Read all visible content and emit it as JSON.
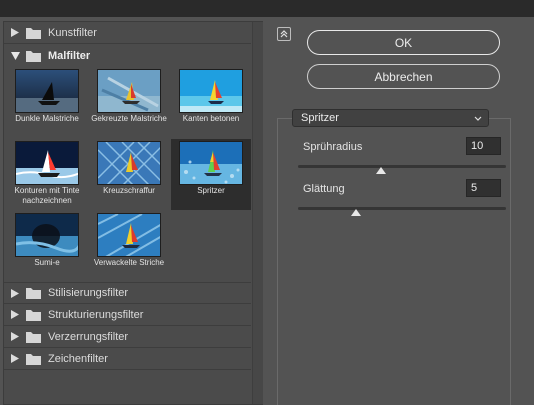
{
  "gallery": {
    "categories_top": [
      {
        "label": "Kunstfilter",
        "expanded": false,
        "icon": "folder-icon"
      },
      {
        "label": "Malfilter",
        "expanded": true,
        "icon": "folder-open-icon"
      }
    ],
    "malfilter_items": [
      {
        "label": "Dunkle Malstriche",
        "selected": false
      },
      {
        "label": "Gekreuzte Malstriche",
        "selected": false
      },
      {
        "label": "Kanten betonen",
        "selected": false
      },
      {
        "label": "Konturen mit Tinte nachzeichnen",
        "selected": false
      },
      {
        "label": "Kreuzschraffur",
        "selected": false
      },
      {
        "label": "Spritzer",
        "selected": true
      },
      {
        "label": "Sumi-e",
        "selected": false
      },
      {
        "label": "Verwackelte Striche",
        "selected": false
      }
    ],
    "categories_bottom": [
      {
        "label": "Stilisierungsfilter"
      },
      {
        "label": "Strukturierungsfilter"
      },
      {
        "label": "Verzerrungsfilter"
      },
      {
        "label": "Zeichenfilter"
      }
    ]
  },
  "buttons": {
    "ok_label": "OK",
    "cancel_label": "Abbrechen"
  },
  "filter_select": {
    "value": "Spritzer"
  },
  "params": [
    {
      "label": "Sprühradius",
      "value": "10",
      "slider_fraction": 0.4
    },
    {
      "label": "Glättung",
      "value": "5",
      "slider_fraction": 0.28
    }
  ],
  "colors": {
    "background": "#535353",
    "panel": "#4b4b4b",
    "selected": "#2d2d2d",
    "input": "#303030"
  }
}
